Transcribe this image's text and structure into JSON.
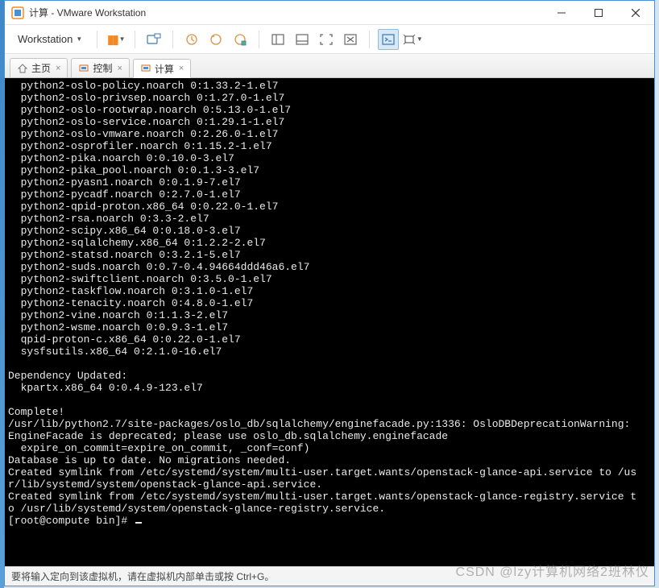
{
  "window": {
    "title": "计算 - VMware Workstation"
  },
  "toolbar": {
    "workstation_label": "Workstation"
  },
  "tabs": [
    {
      "label": "主页",
      "icon": "home"
    },
    {
      "label": "控制",
      "icon": "vm"
    },
    {
      "label": "计算",
      "icon": "vm"
    }
  ],
  "terminal_lines": [
    "  python2-oslo-policy.noarch 0:1.33.2-1.el7",
    "  python2-oslo-privsep.noarch 0:1.27.0-1.el7",
    "  python2-oslo-rootwrap.noarch 0:5.13.0-1.el7",
    "  python2-oslo-service.noarch 0:1.29.1-1.el7",
    "  python2-oslo-vmware.noarch 0:2.26.0-1.el7",
    "  python2-osprofiler.noarch 0:1.15.2-1.el7",
    "  python2-pika.noarch 0:0.10.0-3.el7",
    "  python2-pika_pool.noarch 0:0.1.3-3.el7",
    "  python2-pyasn1.noarch 0:0.1.9-7.el7",
    "  python2-pycadf.noarch 0:2.7.0-1.el7",
    "  python2-qpid-proton.x86_64 0:0.22.0-1.el7",
    "  python2-rsa.noarch 0:3.3-2.el7",
    "  python2-scipy.x86_64 0:0.18.0-3.el7",
    "  python2-sqlalchemy.x86_64 0:1.2.2-2.el7",
    "  python2-statsd.noarch 0:3.2.1-5.el7",
    "  python2-suds.noarch 0:0.7-0.4.94664ddd46a6.el7",
    "  python2-swiftclient.noarch 0:3.5.0-1.el7",
    "  python2-taskflow.noarch 0:3.1.0-1.el7",
    "  python2-tenacity.noarch 0:4.8.0-1.el7",
    "  python2-vine.noarch 0:1.1.3-2.el7",
    "  python2-wsme.noarch 0:0.9.3-1.el7",
    "  qpid-proton-c.x86_64 0:0.22.0-1.el7",
    "  sysfsutils.x86_64 0:2.1.0-16.el7",
    "",
    "Dependency Updated:",
    "  kpartx.x86_64 0:0.4.9-123.el7",
    "",
    "Complete!",
    "/usr/lib/python2.7/site-packages/oslo_db/sqlalchemy/enginefacade.py:1336: OsloDBDeprecationWarning:",
    "EngineFacade is deprecated; please use oslo_db.sqlalchemy.enginefacade",
    "  expire_on_commit=expire_on_commit, _conf=conf)",
    "Database is up to date. No migrations needed.",
    "Created symlink from /etc/systemd/system/multi-user.target.wants/openstack-glance-api.service to /us",
    "r/lib/systemd/system/openstack-glance-api.service.",
    "Created symlink from /etc/systemd/system/multi-user.target.wants/openstack-glance-registry.service t",
    "o /usr/lib/systemd/system/openstack-glance-registry.service."
  ],
  "prompt": "[root@compute bin]# ",
  "statusbar": {
    "hint": "要将输入定向到该虚拟机，请在虚拟机内部单击或按 Ctrl+G。"
  },
  "watermark": "CSDN @lzy计算机网络2班林仪"
}
